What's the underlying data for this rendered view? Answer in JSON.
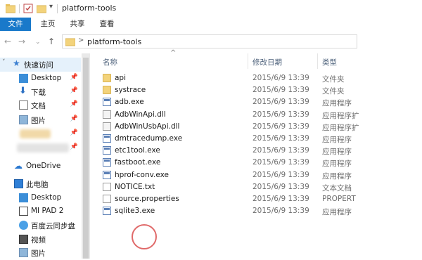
{
  "window": {
    "title": "platform-tools"
  },
  "ribbon": {
    "tabs": [
      "文件",
      "主页",
      "共享",
      "查看"
    ]
  },
  "address": {
    "path_segment": "platform-tools",
    "separator": ">"
  },
  "nav": {
    "quick_access": "快速访问",
    "items": [
      {
        "label": "Desktop",
        "icon": "desktop-icon",
        "pinned": true
      },
      {
        "label": "下载",
        "icon": "download-icon",
        "pinned": true
      },
      {
        "label": "文档",
        "icon": "documents-icon",
        "pinned": true
      },
      {
        "label": "图片",
        "icon": "pictures-icon",
        "pinned": true
      }
    ],
    "onedrive": "OneDrive",
    "this_pc": "此电脑",
    "pc_items": [
      {
        "label": "Desktop",
        "icon": "desktop-icon"
      },
      {
        "label": "MI PAD 2",
        "icon": "device-icon"
      },
      {
        "label": "百度云同步盘",
        "icon": "cloud-sync-icon"
      },
      {
        "label": "视频",
        "icon": "video-icon"
      },
      {
        "label": "图片",
        "icon": "pictures-icon"
      }
    ]
  },
  "columns": {
    "name": "名称",
    "date": "修改日期",
    "type": "类型"
  },
  "files": [
    {
      "name": "api",
      "date": "2015/6/9 13:39",
      "type": "文件夹",
      "icon": "folder"
    },
    {
      "name": "systrace",
      "date": "2015/6/9 13:39",
      "type": "文件夹",
      "icon": "folder"
    },
    {
      "name": "adb.exe",
      "date": "2015/6/9 13:39",
      "type": "应用程序",
      "icon": "exe"
    },
    {
      "name": "AdbWinApi.dll",
      "date": "2015/6/9 13:39",
      "type": "应用程序扩",
      "icon": "dll"
    },
    {
      "name": "AdbWinUsbApi.dll",
      "date": "2015/6/9 13:39",
      "type": "应用程序扩",
      "icon": "dll"
    },
    {
      "name": "dmtracedump.exe",
      "date": "2015/6/9 13:39",
      "type": "应用程序",
      "icon": "exe"
    },
    {
      "name": "etc1tool.exe",
      "date": "2015/6/9 13:39",
      "type": "应用程序",
      "icon": "exe"
    },
    {
      "name": "fastboot.exe",
      "date": "2015/6/9 13:39",
      "type": "应用程序",
      "icon": "exe"
    },
    {
      "name": "hprof-conv.exe",
      "date": "2015/6/9 13:39",
      "type": "应用程序",
      "icon": "exe"
    },
    {
      "name": "NOTICE.txt",
      "date": "2015/6/9 13:39",
      "type": "文本文档",
      "icon": "txt"
    },
    {
      "name": "source.properties",
      "date": "2015/6/9 13:39",
      "type": "PROPERT",
      "icon": "txt"
    },
    {
      "name": "sqlite3.exe",
      "date": "2015/6/9 13:39",
      "type": "应用程序",
      "icon": "exe"
    }
  ]
}
